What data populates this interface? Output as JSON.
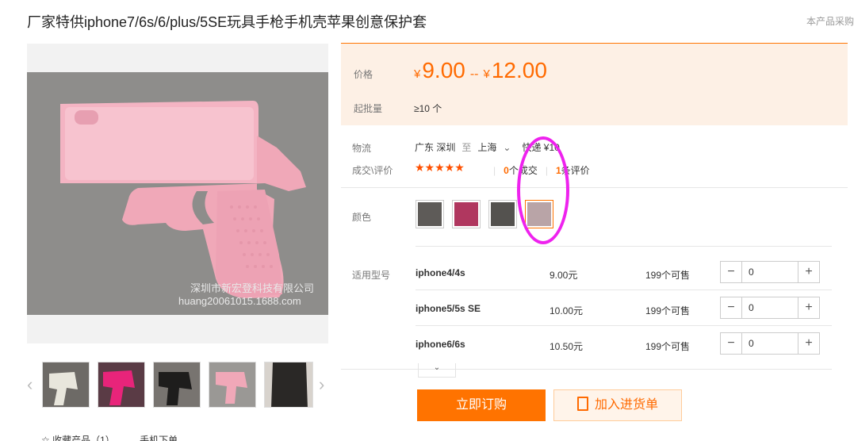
{
  "title": "厂家特供iphone7/6s/6/plus/5SE玩具手枪手机壳苹果创意保护套",
  "top_note": "本产品采购",
  "main_image": {
    "watermark_line1": "深圳市新宏登科技有限公司",
    "watermark_line2": "huang20061015.1688.com"
  },
  "thumbs": [
    "white gun case",
    "pink gun case",
    "black gun case",
    "pink gun case 2",
    "gun case in pocket"
  ],
  "price": {
    "label": "价格",
    "currency": "¥",
    "low": "9.00",
    "sep": "--",
    "high": "12.00"
  },
  "moq": {
    "label": "起批量",
    "value": "≥10 个"
  },
  "logistics": {
    "label": "物流",
    "from": "广东 深圳",
    "to_word": "至",
    "to": "上海",
    "method": "快递 ¥10"
  },
  "deal": {
    "label": "成交\\评价",
    "stars": "★★★★★",
    "deals": "0",
    "deals_suffix": "个成交",
    "reviews": "1",
    "reviews_suffix": "条评价"
  },
  "colors": {
    "label": "颜色",
    "swatch_colors": [
      "#5e5b58",
      "#b0375f",
      "#54524f",
      "#b9a4a7"
    ],
    "selected_index": 3
  },
  "models": {
    "label": "适用型号",
    "rows": [
      {
        "name": "iphone4/4s",
        "price": "9.00元",
        "stock": "199个可售",
        "qty": "0"
      },
      {
        "name": "iphone5/5s SE",
        "price": "10.00元",
        "stock": "199个可售",
        "qty": "0"
      },
      {
        "name": "iphone6/6s",
        "price": "10.50元",
        "stock": "199个可售",
        "qty": "0"
      }
    ]
  },
  "buttons": {
    "order": "立即订购",
    "cart": "加入进货单"
  },
  "bottom": {
    "fav": "☆ 收藏产品（1）",
    "phone": "手机下单"
  },
  "colors_theme": {
    "accent": "#ff7300",
    "annotation": "#ee22ee"
  }
}
